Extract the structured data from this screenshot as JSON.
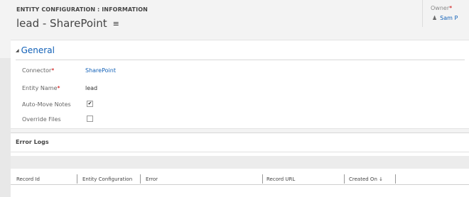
{
  "header": {
    "breadcrumb": "ENTITY CONFIGURATION : INFORMATION",
    "title": "lead - SharePoint",
    "menu_icon": "≡",
    "owner_label": "Owner",
    "owner_required": "*",
    "owner_value": "Sam P"
  },
  "general": {
    "section_title": "General",
    "fields": [
      {
        "label": "Connector",
        "required": "*",
        "value": "SharePoint"
      },
      {
        "label": "Entity Name",
        "required": "*",
        "value": "lead"
      },
      {
        "label": "Auto-Move Notes",
        "checked": true,
        "check_glyph": "✔"
      },
      {
        "label": "Override Files",
        "checked": false,
        "check_glyph": ""
      }
    ]
  },
  "error_logs": {
    "title": "Error Logs",
    "columns": [
      "Record Id",
      "Entity Configuration",
      "Error",
      "Record URL",
      "Created On"
    ],
    "sort_indicator": "↓"
  },
  "colors": {
    "accent": "#1160b7",
    "required": "#cc0000",
    "background": "#f3f3f3"
  },
  "icons": {
    "owner": "user-icon",
    "menu": "hamburger-menu-icon",
    "collapse": "collapse-triangle-icon",
    "sort": "sort-descending-icon"
  }
}
